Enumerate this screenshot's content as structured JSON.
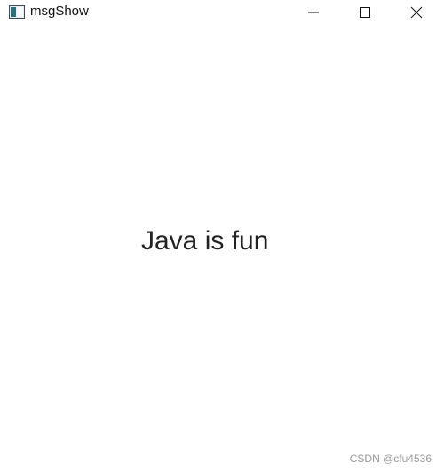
{
  "window": {
    "title": "msgShow",
    "app_icon": "java-window-icon",
    "controls": {
      "minimize_icon": "minimize-icon",
      "maximize_icon": "maximize-icon",
      "close_icon": "close-icon"
    }
  },
  "content": {
    "message": "Java is fun"
  },
  "watermark": {
    "text": "CSDN @cfu4536"
  }
}
